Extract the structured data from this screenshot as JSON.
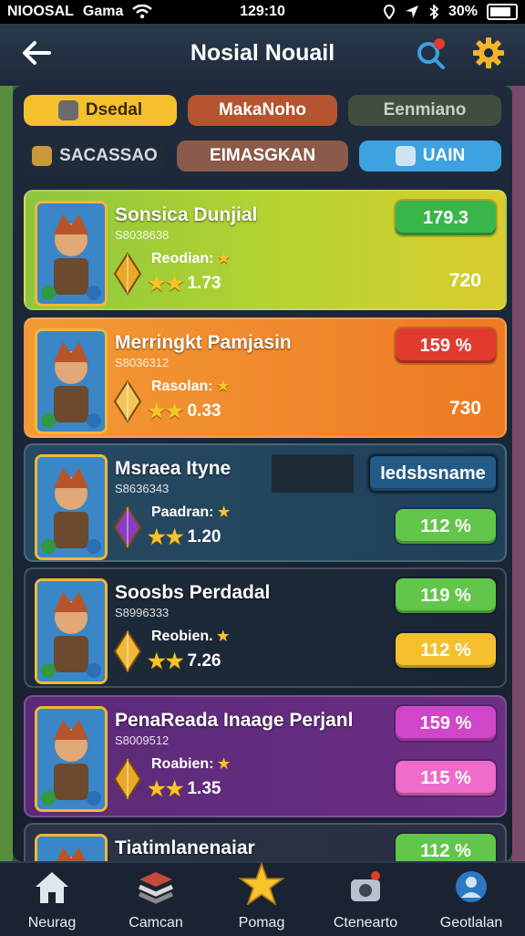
{
  "status_bar": {
    "carrier": "NIOOSAL",
    "app": "Gama",
    "time": "129:10",
    "battery": "30%"
  },
  "header": {
    "title": "Nosial Nouail"
  },
  "tabs": [
    {
      "label": "Dsedal",
      "color": "#f4c02e",
      "text_color": "#3a2a00"
    },
    {
      "label": "MakaNoho",
      "color": "#b5542e",
      "text_color": "#ffffff"
    },
    {
      "label": "Eenmiano",
      "color": "#3f4e3f",
      "text_color": "#c9d1c9"
    },
    {
      "label": "SACASSAO",
      "color": "#202b3a",
      "text_color": "#d3dae3"
    },
    {
      "label": "EIMASGKAN",
      "color": "#8a5a4a",
      "text_color": "#ffffff"
    },
    {
      "label": "UAIN",
      "color": "#3da2df",
      "text_color": "#ffffff"
    }
  ],
  "cards": [
    {
      "name": "Sonsica Dunjial",
      "id": "S8038638",
      "label": "Reodian:",
      "value": "1.73",
      "btn1": "179.3",
      "btn1_color": "#39b54a",
      "btn2": "",
      "btn2_color": "",
      "side_value": "720",
      "bg": "linear-gradient(90deg,#8dc63f 0%,#b7d430 55%,#d9cc2e 100%)",
      "gem": "#e8a92a"
    },
    {
      "name": "Merringkt Pamjasin",
      "id": "S8036312",
      "label": "Rasolan:",
      "value": "0.33",
      "btn1": "159 %",
      "btn1_color": "#e03b2e",
      "btn2": "",
      "btn2_color": "",
      "side_value": "730",
      "bg": "linear-gradient(90deg,#f39a34 0%,#f0882c 55%,#ee7a22 100%)",
      "gem": "#f4c55a"
    },
    {
      "name": "Msraea Ityne",
      "id": "S8636343",
      "label": "Paadran:",
      "value": "1.20",
      "btn1": "Iedsbsname",
      "btn1_color": "#245a86",
      "btn2": "112 %",
      "btn2_color": "#62c64a",
      "side_value": "",
      "bg": "linear-gradient(90deg,#274a63 0%,#1f4058 100%)",
      "gem": "#8a3cc2"
    },
    {
      "name": "Soosbs Perdadal",
      "id": "S8996333",
      "label": "Reobien.",
      "value": "7.26",
      "btn1": "119 %",
      "btn1_color": "#62c64a",
      "btn2": "112 %",
      "btn2_color": "#f4c02e",
      "side_value": "",
      "bg": "linear-gradient(90deg,#1d2a3a 0%,#1a2634 100%)",
      "gem": "#f0b83a"
    },
    {
      "name": "PenaReada Inaage Perjanl",
      "id": "S8009512",
      "label": "Roabien:",
      "value": "1.35",
      "btn1": "159 %",
      "btn1_color": "#d046c8",
      "btn2": "115 %",
      "btn2_color": "#ef6ccb",
      "side_value": "",
      "bg": "linear-gradient(90deg,#5a2a78 0%,#6b2e84 100%)",
      "gem": "#e8a92a"
    },
    {
      "name": "Tiatimlanenaiar",
      "id": "",
      "label": "",
      "value": "",
      "btn1": "112 %",
      "btn1_color": "#62c64a",
      "btn2": "",
      "btn2_color": "",
      "side_value": "",
      "bg": "linear-gradient(90deg,#2a3346 0%,#283044 100%)",
      "gem": ""
    }
  ],
  "nav": [
    {
      "label": "Neurag",
      "icon": "home-icon"
    },
    {
      "label": "Camcan",
      "icon": "stack-icon"
    },
    {
      "label": "Pomag",
      "icon": "star-icon"
    },
    {
      "label": "Ctenearto",
      "icon": "camera-icon"
    },
    {
      "label": "Geotlalan",
      "icon": "profile-icon"
    }
  ]
}
